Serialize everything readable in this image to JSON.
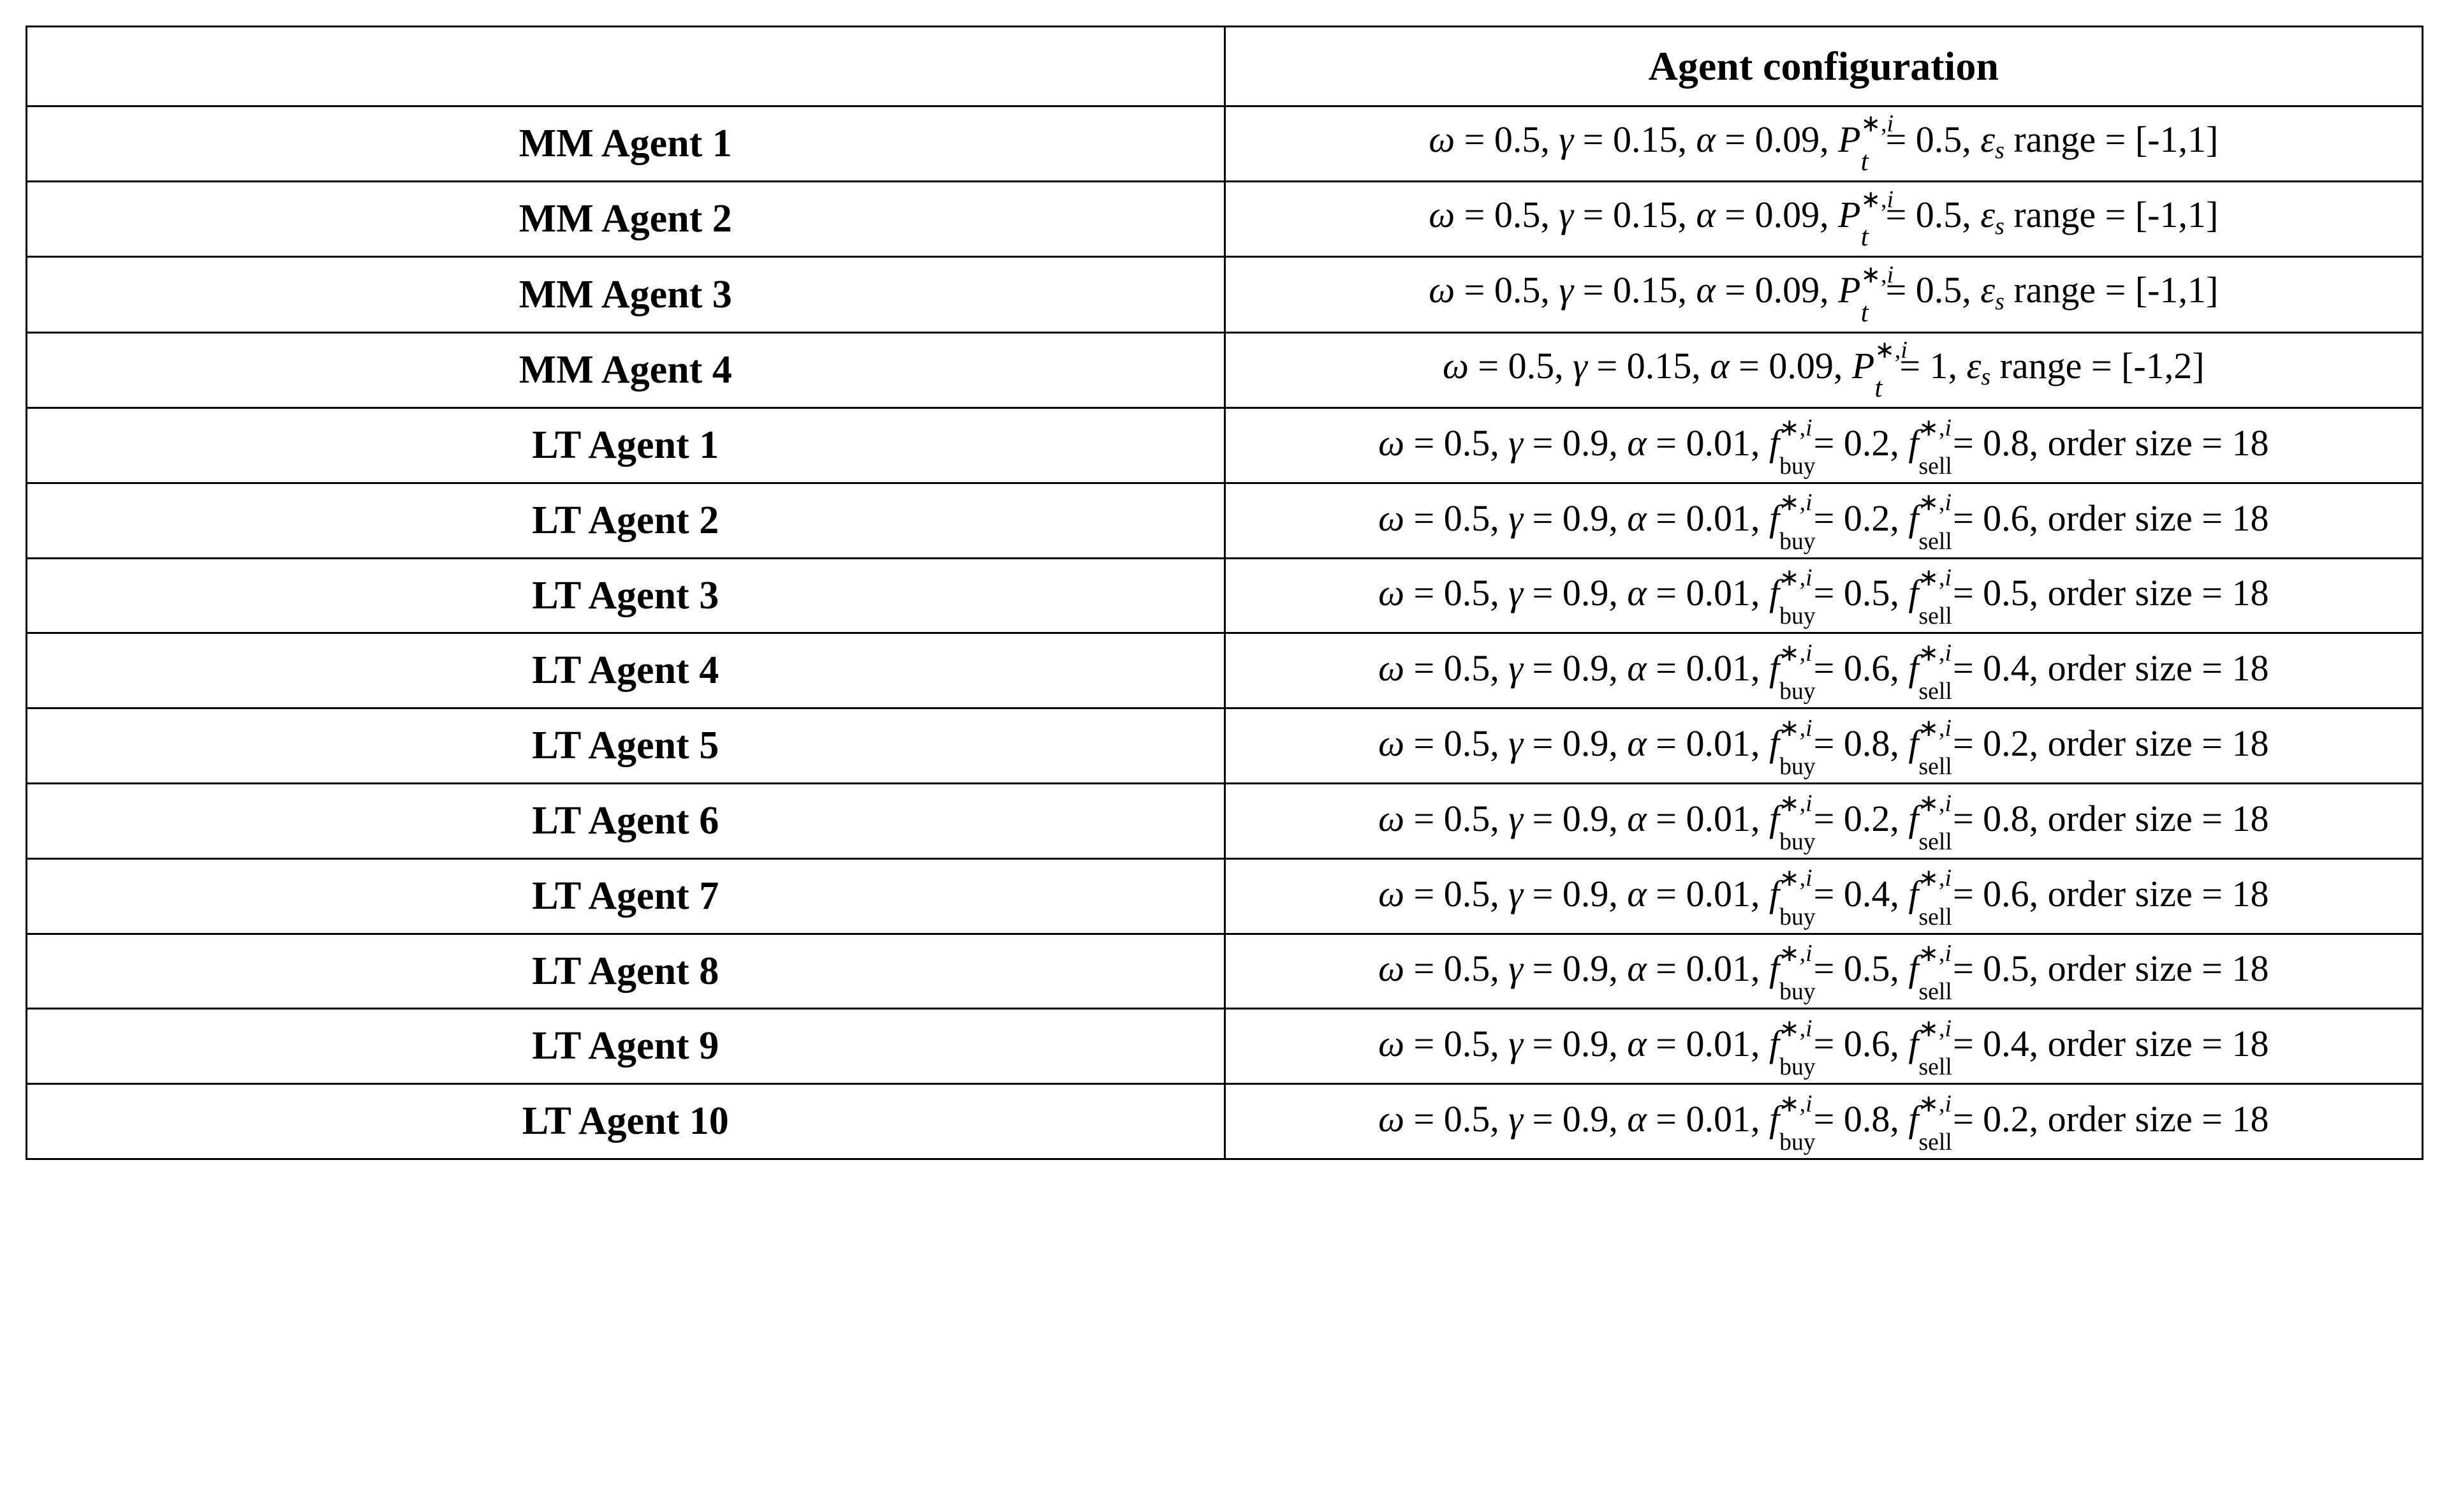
{
  "header": {
    "blank": "",
    "config": "Agent configuration"
  },
  "rows": [
    {
      "label": "MM Agent 1",
      "type": "mm",
      "omega": "0.5",
      "gamma": "0.15",
      "alpha": "0.09",
      "P": "0.5",
      "eps_range": "[-1,1]"
    },
    {
      "label": "MM Agent 2",
      "type": "mm",
      "omega": "0.5",
      "gamma": "0.15",
      "alpha": "0.09",
      "P": "0.5",
      "eps_range": "[-1,1]"
    },
    {
      "label": "MM Agent 3",
      "type": "mm",
      "omega": "0.5",
      "gamma": "0.15",
      "alpha": "0.09",
      "P": "0.5",
      "eps_range": "[-1,1]"
    },
    {
      "label": "MM Agent 4",
      "type": "mm",
      "omega": "0.5",
      "gamma": "0.15",
      "alpha": "0.09",
      "P": "1",
      "eps_range": "[-1,2]"
    },
    {
      "label": "LT Agent 1",
      "type": "lt",
      "omega": "0.5",
      "gamma": "0.9",
      "alpha": "0.01",
      "fbuy": "0.2",
      "fsell": "0.8",
      "order_size": "18"
    },
    {
      "label": "LT Agent 2",
      "type": "lt",
      "omega": "0.5",
      "gamma": "0.9",
      "alpha": "0.01",
      "fbuy": "0.2",
      "fsell": "0.6",
      "order_size": "18"
    },
    {
      "label": "LT Agent 3",
      "type": "lt",
      "omega": "0.5",
      "gamma": "0.9",
      "alpha": "0.01",
      "fbuy": "0.5",
      "fsell": "0.5",
      "order_size": "18"
    },
    {
      "label": "LT Agent 4",
      "type": "lt",
      "omega": "0.5",
      "gamma": "0.9",
      "alpha": "0.01",
      "fbuy": "0.6",
      "fsell": "0.4",
      "order_size": "18"
    },
    {
      "label": "LT Agent 5",
      "type": "lt",
      "omega": "0.5",
      "gamma": "0.9",
      "alpha": "0.01",
      "fbuy": "0.8",
      "fsell": "0.2",
      "order_size": "18"
    },
    {
      "label": "LT Agent 6",
      "type": "lt",
      "omega": "0.5",
      "gamma": "0.9",
      "alpha": "0.01",
      "fbuy": "0.2",
      "fsell": "0.8",
      "order_size": "18"
    },
    {
      "label": "LT Agent 7",
      "type": "lt",
      "omega": "0.5",
      "gamma": "0.9",
      "alpha": "0.01",
      "fbuy": "0.4",
      "fsell": "0.6",
      "order_size": "18"
    },
    {
      "label": "LT Agent 8",
      "type": "lt",
      "omega": "0.5",
      "gamma": "0.9",
      "alpha": "0.01",
      "fbuy": "0.5",
      "fsell": "0.5",
      "order_size": "18"
    },
    {
      "label": "LT Agent 9",
      "type": "lt",
      "omega": "0.5",
      "gamma": "0.9",
      "alpha": "0.01",
      "fbuy": "0.6",
      "fsell": "0.4",
      "order_size": "18"
    },
    {
      "label": "LT Agent 10",
      "type": "lt",
      "omega": "0.5",
      "gamma": "0.9",
      "alpha": "0.01",
      "fbuy": "0.8",
      "fsell": "0.2",
      "order_size": "18"
    }
  ],
  "labels": {
    "order_size": "order size",
    "range": "range"
  }
}
